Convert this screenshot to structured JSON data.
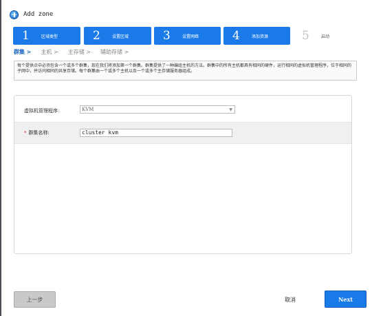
{
  "header": {
    "title": "Add zone",
    "icon": "add-circle-icon"
  },
  "steps": [
    {
      "number": "1",
      "label": "区域类型"
    },
    {
      "number": "2",
      "label": "设置区域"
    },
    {
      "number": "3",
      "label": "设置网络"
    },
    {
      "number": "4",
      "label": "添加资源"
    },
    {
      "number": "5",
      "label": "启动"
    }
  ],
  "subtabs": [
    "群集 >",
    "主机 >",
    "主存储 >",
    "辅助存储 >"
  ],
  "info_text": "每个提供点中必须包含一个或多个群集，现在我们将添加第一个群集。群集提供了一种编组主机的方法。群集中的所有主机都具有相同的硬件，运行相同的虚拟机管理程序，位于相同的子网中，并访问相同的共享存储。每个群集由一个或多个主机以及一个或多个主存储服务器组成。",
  "form": {
    "hypervisor_label": "虚拟机管理程序:",
    "hypervisor_value": "KVM",
    "cluster_name_required": "*",
    "cluster_name_label": "群集名称:",
    "cluster_name_value": "cluster kvm"
  },
  "footer": {
    "prev_label": "上一步",
    "cancel_label": "取消",
    "next_label": "Next"
  },
  "colors": {
    "accent": "#1a7ae8",
    "required": "#e02020"
  }
}
